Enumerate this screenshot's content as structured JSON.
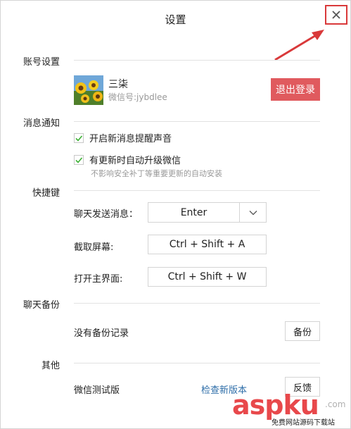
{
  "window": {
    "title": "设置",
    "close_symbol": "✕"
  },
  "colors": {
    "accent_red": "#e05a5e",
    "link_blue": "#2d6da8",
    "check_green": "#3cb034",
    "annotation_red": "#d9393a"
  },
  "account": {
    "section_label": "账号设置",
    "nickname": "三柒",
    "wechat_id": "微信号:jybdlee",
    "logout_label": "退出登录",
    "avatar": "sunflower-photo"
  },
  "notify": {
    "section_label": "消息通知",
    "options": [
      {
        "label": "开启新消息提醒声音",
        "checked": true
      },
      {
        "label": "有更新时自动升级微信",
        "checked": true
      }
    ],
    "hint": "不影响安全补丁等重要更新的自动安装"
  },
  "shortcuts": {
    "section_label": "快捷键",
    "send_label": "聊天发送消息：",
    "send_value": "Enter",
    "capture_label": "截取屏幕:",
    "capture_value": "Ctrl + Shift + A",
    "open_label": "打开主界面:",
    "open_value": "Ctrl + Shift + W"
  },
  "backup": {
    "section_label": "聊天备份",
    "empty_text": "没有备份记录",
    "backup_label": "备份"
  },
  "other": {
    "section_label": "其他",
    "version_text": "微信测试版",
    "check_update_label": "检查新版本",
    "feedback_label": "反馈"
  },
  "watermark": {
    "brand": "aspku",
    "suffix": ".com",
    "sub": "免费网站源码下载站"
  }
}
